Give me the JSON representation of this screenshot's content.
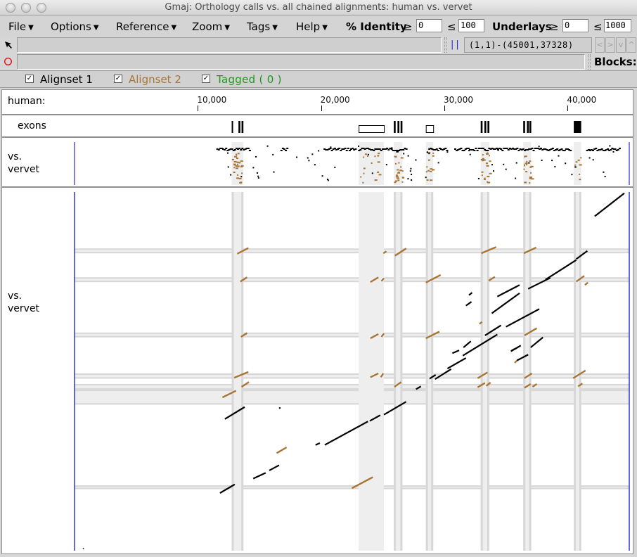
{
  "window": {
    "title": "Gmaj: Orthology calls vs. all chained alignments: human vs. vervet"
  },
  "menubar": {
    "menus": [
      "File",
      "Options",
      "Reference",
      "Zoom",
      "Tags",
      "Help"
    ],
    "identity_label": "% Identity",
    "identity_min": "0",
    "identity_max": "100",
    "underlays_label": "Underlays",
    "underlays_min": "0",
    "underlays_max": "1000",
    "ge_symbol": "≥",
    "le_symbol": "≤"
  },
  "toolbar": {
    "pointer_icon": "arrow-cursor-icon",
    "mark_icon": "red-circle-icon",
    "selection_field": "",
    "mark_field": "",
    "split_icon": "||",
    "coords": "(1,1)-(45001,37328)",
    "nav_buttons": [
      "<",
      ">",
      "v",
      "^"
    ],
    "blocks_label": "Blocks:"
  },
  "alignsets": [
    {
      "label": "Alignset 1",
      "checked": true,
      "color": "#000000"
    },
    {
      "label": "Alignset 2",
      "checked": true,
      "color": "#a87535"
    },
    {
      "label": "Tagged  ( 0 )",
      "checked": true,
      "color": "#1a9a1a"
    }
  ],
  "ruler": {
    "label": "human:",
    "ticks": [
      {
        "label": "10,000",
        "pos": 10000
      },
      {
        "label": "20,000",
        "pos": 20000
      },
      {
        "label": "30,000",
        "pos": 30000
      },
      {
        "label": "40,000",
        "pos": 40000
      }
    ],
    "range": [
      1,
      45001
    ]
  },
  "exons": {
    "label": "exons",
    "features": [
      {
        "start": 12750,
        "end": 12850,
        "style": "filled"
      },
      {
        "start": 13300,
        "end": 13450,
        "style": "filled"
      },
      {
        "start": 13550,
        "end": 13700,
        "style": "filled"
      },
      {
        "start": 23050,
        "end": 25100,
        "style": "outline"
      },
      {
        "start": 25900,
        "end": 26050,
        "style": "filled"
      },
      {
        "start": 26200,
        "end": 26350,
        "style": "filled"
      },
      {
        "start": 26450,
        "end": 26600,
        "style": "filled"
      },
      {
        "start": 28500,
        "end": 29100,
        "style": "outline"
      },
      {
        "start": 32950,
        "end": 33100,
        "style": "filled"
      },
      {
        "start": 33250,
        "end": 33400,
        "style": "filled"
      },
      {
        "start": 33500,
        "end": 33650,
        "style": "filled"
      },
      {
        "start": 36400,
        "end": 36550,
        "style": "filled"
      },
      {
        "start": 36700,
        "end": 36850,
        "style": "filled"
      },
      {
        "start": 36900,
        "end": 37050,
        "style": "filled"
      },
      {
        "start": 40500,
        "end": 41100,
        "style": "filled"
      }
    ]
  },
  "pip_panel": {
    "label_line1": "vs.",
    "label_line2": "vervet"
  },
  "dotplot_panel": {
    "label_line1": "vs.",
    "label_line2": "vervet",
    "vervet_range": [
      1,
      37328
    ]
  },
  "colors": {
    "alignset1": "#000000",
    "alignset2": "#a87535",
    "tagged": "#1a9a1a",
    "axis_line": "#0000c8",
    "underlay_light": "#eeeeee",
    "underlay_dark": "#d7d7d7"
  },
  "underlays_x": [
    {
      "start": 12750,
      "end": 13700
    },
    {
      "start": 23050,
      "end": 25100
    },
    {
      "start": 25900,
      "end": 26600
    },
    {
      "start": 28500,
      "end": 29100
    },
    {
      "start": 32950,
      "end": 33650
    },
    {
      "start": 36400,
      "end": 37050
    },
    {
      "start": 40500,
      "end": 41100
    }
  ],
  "underlays_y": [
    {
      "start": 30950,
      "end": 31450
    },
    {
      "start": 27950,
      "end": 28450
    },
    {
      "start": 22200,
      "end": 22700
    },
    {
      "start": 17900,
      "end": 18450
    },
    {
      "start": 16750,
      "end": 17350
    },
    {
      "start": 15200,
      "end": 16750
    },
    {
      "start": 6400,
      "end": 6800
    }
  ],
  "alignments_main": [
    [
      700,
      200,
      750,
      250
    ],
    [
      11800,
      6000,
      13000,
      6900
    ],
    [
      14500,
      7500,
      15500,
      8100
    ],
    [
      15800,
      8350,
      16600,
      8900
    ],
    [
      12200,
      13700,
      13800,
      14950
    ],
    [
      19550,
      11000,
      19900,
      11200
    ],
    [
      20300,
      11000,
      23800,
      13450
    ],
    [
      23950,
      13500,
      24800,
      14100
    ],
    [
      25100,
      14150,
      26900,
      15500
    ],
    [
      16600,
      14800,
      16700,
      14900
    ],
    [
      30250,
      18950,
      31750,
      20050
    ],
    [
      29250,
      17850,
      30550,
      18900
    ],
    [
      31500,
      20300,
      34300,
      22500
    ],
    [
      30650,
      20550,
      31200,
      20850
    ],
    [
      31550,
      21150,
      32150,
      21800
    ],
    [
      33300,
      22400,
      34600,
      23450
    ],
    [
      35400,
      20750,
      36200,
      21350
    ],
    [
      35900,
      19800,
      36800,
      20400
    ],
    [
      37000,
      21150,
      38000,
      22200
    ],
    [
      33850,
      24700,
      36100,
      26800
    ],
    [
      35000,
      23300,
      37700,
      25150
    ],
    [
      34300,
      26450,
      36100,
      27650
    ],
    [
      36800,
      27250,
      38600,
      28400
    ],
    [
      38200,
      28200,
      40700,
      30250
    ],
    [
      40700,
      30350,
      41600,
      31200
    ],
    [
      42200,
      34800,
      44600,
      37200
    ],
    [
      32000,
      26600,
      32250,
      26850
    ],
    [
      31750,
      25500,
      32200,
      25900
    ],
    [
      28800,
      17900,
      29300,
      18300
    ],
    [
      27700,
      16800,
      28100,
      17100
    ]
  ],
  "alignments_secondary": [
    [
      13200,
      30900,
      14100,
      31500
    ],
    [
      13450,
      28000,
      14000,
      28450
    ],
    [
      13500,
      22250,
      14000,
      22650
    ],
    [
      12950,
      18000,
      14100,
      18600
    ],
    [
      13550,
      17050,
      14150,
      17550
    ],
    [
      12000,
      15950,
      13100,
      16650
    ],
    [
      16400,
      10150,
      17200,
      10750
    ],
    [
      22500,
      6500,
      24200,
      7650
    ],
    [
      25050,
      30950,
      25300,
      31150
    ],
    [
      26000,
      30700,
      26900,
      31450
    ],
    [
      24000,
      27950,
      24650,
      28450
    ],
    [
      24900,
      28050,
      25100,
      28350
    ],
    [
      28500,
      27900,
      29700,
      28700
    ],
    [
      24000,
      22100,
      24650,
      22550
    ],
    [
      24900,
      22250,
      25100,
      22600
    ],
    [
      28500,
      22100,
      29600,
      22800
    ],
    [
      24000,
      18050,
      24650,
      18450
    ],
    [
      24850,
      18050,
      25050,
      18450
    ],
    [
      25950,
      17050,
      26500,
      17550
    ],
    [
      33000,
      30950,
      34200,
      31600
    ],
    [
      36450,
      30950,
      37450,
      31550
    ],
    [
      33600,
      28100,
      34100,
      28500
    ],
    [
      40700,
      28000,
      41350,
      28600
    ],
    [
      32700,
      17950,
      33500,
      18550
    ],
    [
      36500,
      17950,
      37100,
      18450
    ],
    [
      40450,
      17950,
      41450,
      18750
    ],
    [
      32700,
      17000,
      33300,
      17450
    ],
    [
      33400,
      17150,
      33750,
      17500
    ],
    [
      36500,
      16950,
      37000,
      17350
    ],
    [
      37150,
      17050,
      37500,
      17350
    ],
    [
      40850,
      17100,
      41200,
      17400
    ],
    [
      36500,
      22400,
      37500,
      23150
    ],
    [
      35450,
      20850,
      35900,
      21100
    ],
    [
      35700,
      19550,
      36000,
      19900
    ],
    [
      32850,
      23600,
      33050,
      23800
    ],
    [
      41400,
      27650,
      41650,
      27900
    ]
  ]
}
